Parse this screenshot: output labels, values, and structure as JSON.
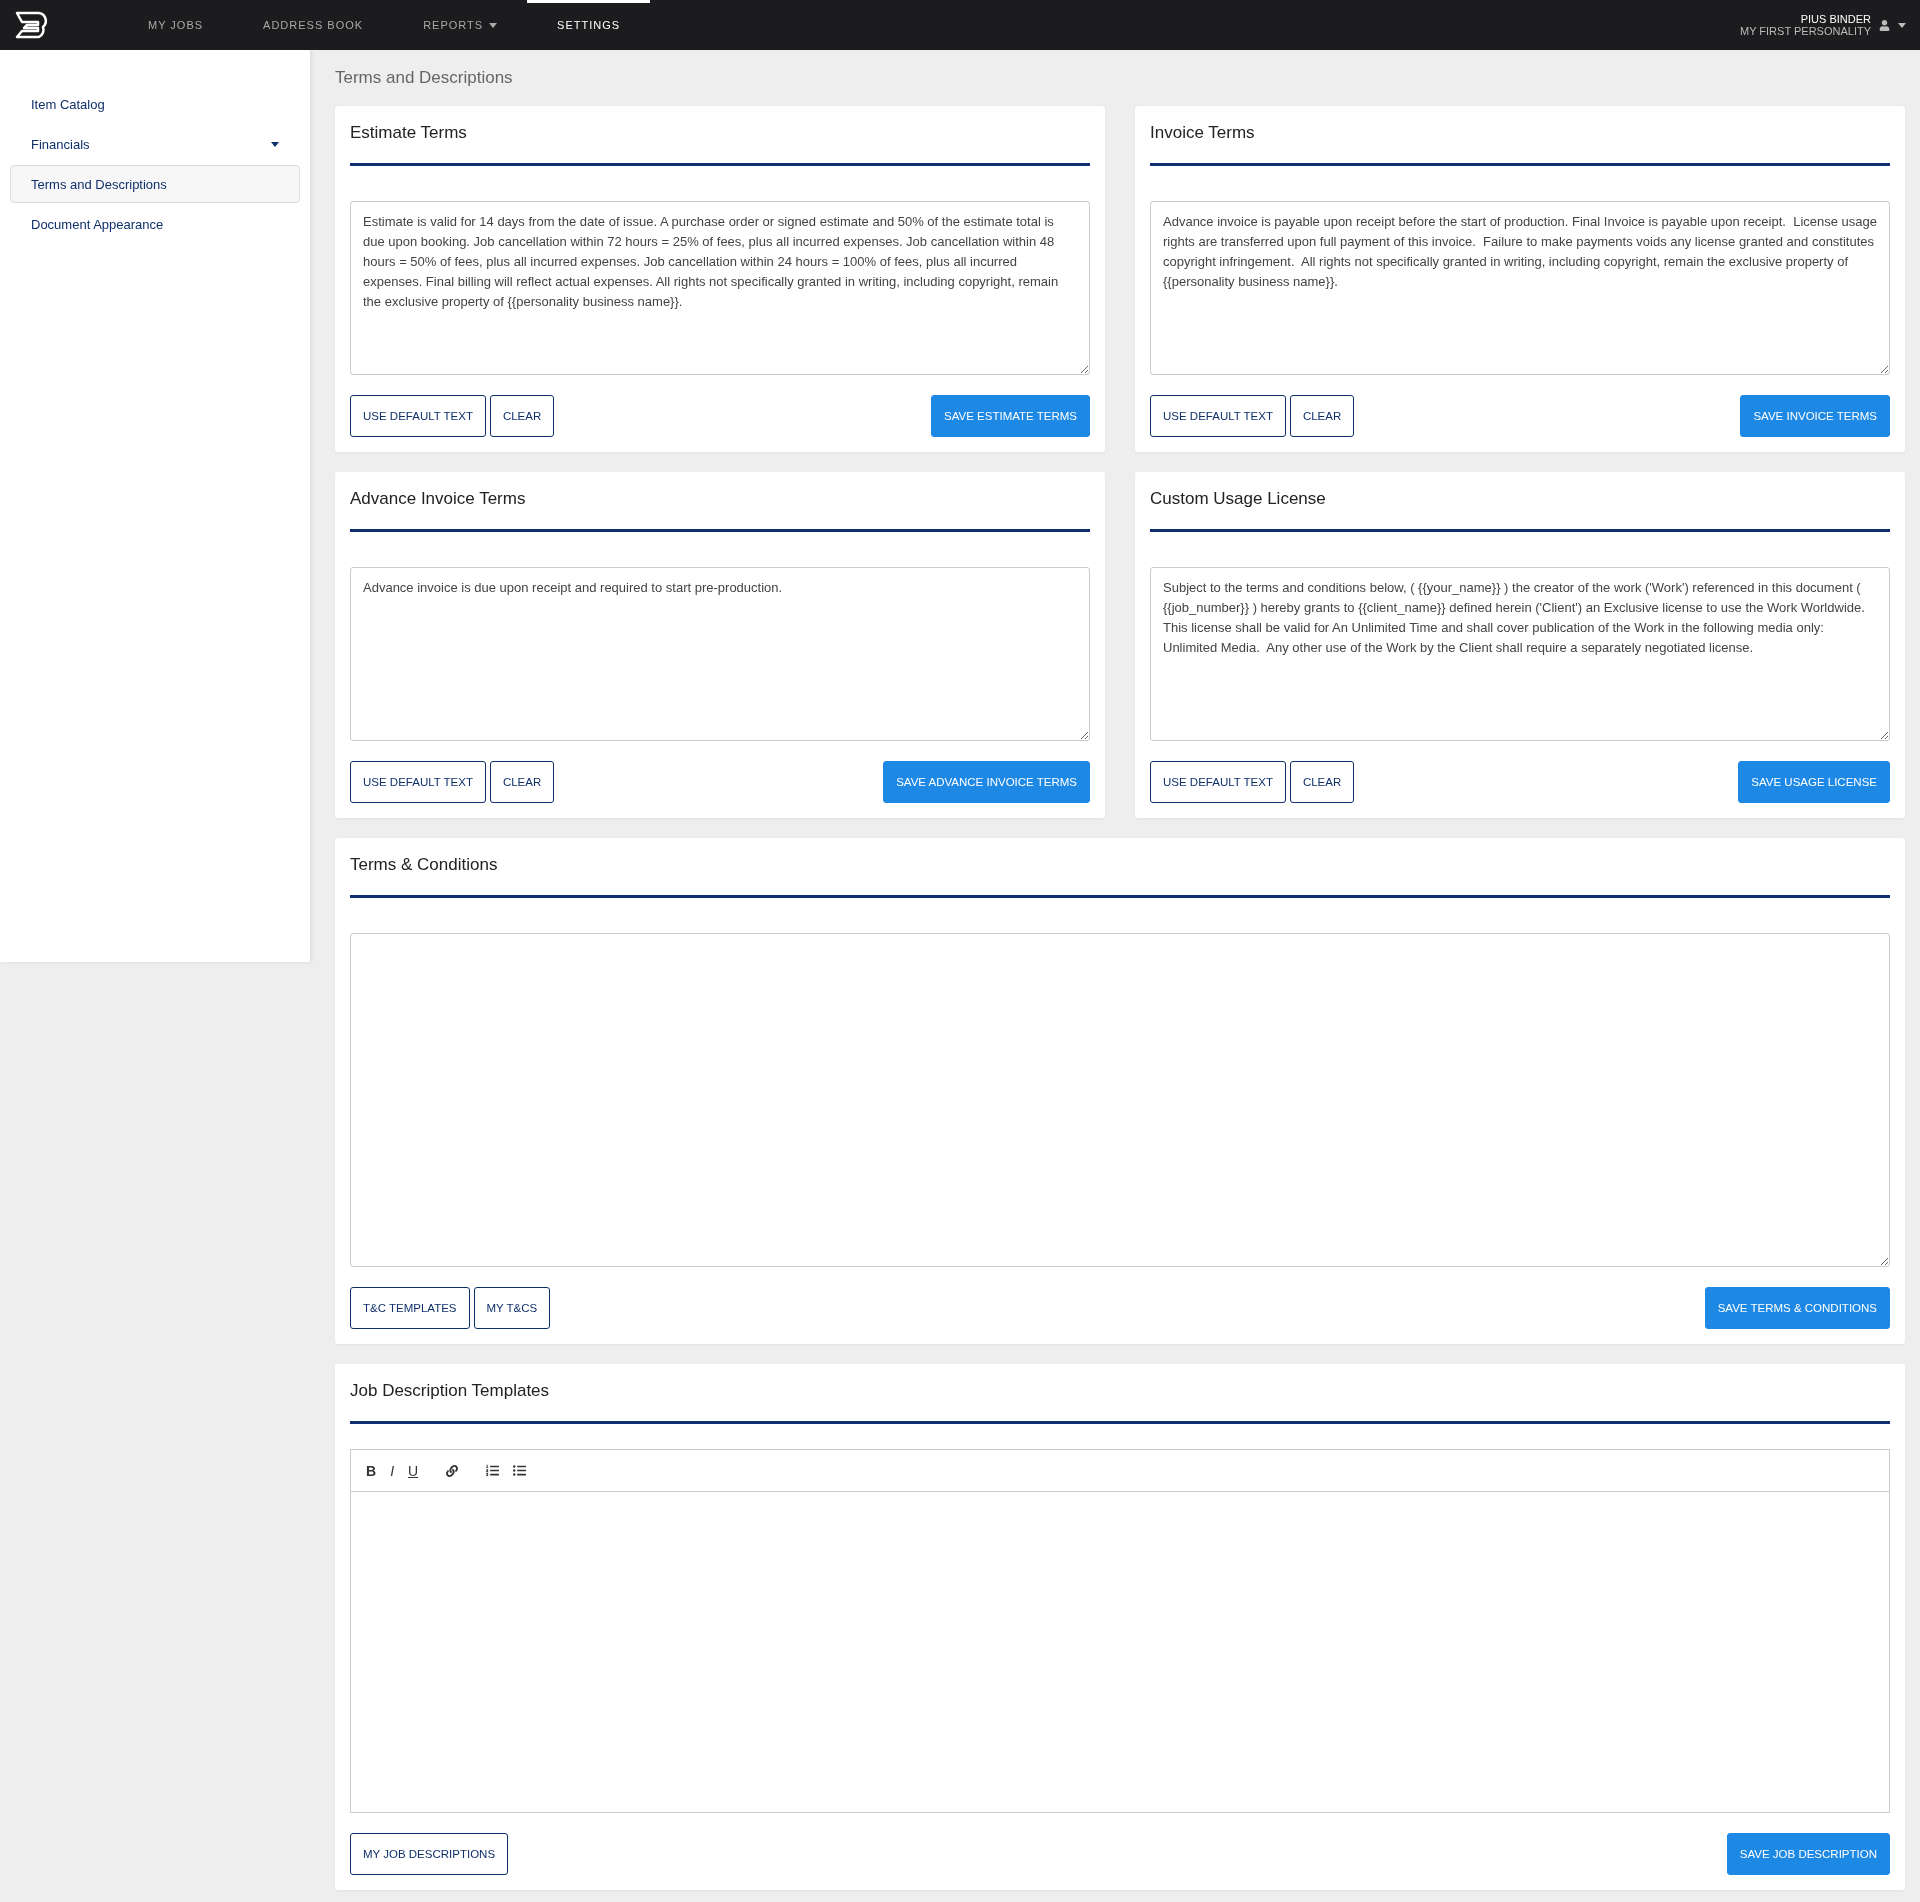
{
  "nav": {
    "items": [
      {
        "label": "MY JOBS",
        "selected": false,
        "dropdown": false
      },
      {
        "label": "ADDRESS BOOK",
        "selected": false,
        "dropdown": false
      },
      {
        "label": "REPORTS",
        "selected": false,
        "dropdown": true
      },
      {
        "label": "SETTINGS",
        "selected": true,
        "dropdown": false
      }
    ],
    "user": {
      "name": "PIUS BINDER",
      "personality": "MY FIRST PERSONALITY"
    }
  },
  "sidebar": {
    "items": [
      {
        "label": "Item Catalog",
        "selected": false,
        "dropdown": false
      },
      {
        "label": "Financials",
        "selected": false,
        "dropdown": true
      },
      {
        "label": "Terms and Descriptions",
        "selected": true,
        "dropdown": false
      },
      {
        "label": "Document Appearance",
        "selected": false,
        "dropdown": false
      }
    ]
  },
  "page_title": "Terms and Descriptions",
  "term_cards": [
    {
      "title": "Estimate Terms",
      "text": "Estimate is valid for 14 days from the date of issue. A purchase order or signed estimate and 50% of the estimate total is due upon booking. Job cancellation within 72 hours = 25% of fees, plus all incurred expenses. Job cancellation within 48 hours = 50% of fees, plus all incurred expenses. Job cancellation within 24 hours = 100% of fees, plus all incurred expenses. Final billing will reflect actual expenses. All rights not specifically granted in writing, including copyright, remain the exclusive property of {{personality business name}}.",
      "buttons": [
        "USE DEFAULT TEXT",
        "CLEAR"
      ],
      "save": "SAVE ESTIMATE TERMS"
    },
    {
      "title": "Invoice Terms",
      "text": "Advance invoice is payable upon receipt before the start of production. Final Invoice is payable upon receipt.  License usage rights are transferred upon full payment of this invoice.  Failure to make payments voids any license granted and constitutes copyright infringement.  All rights not specifically granted in writing, including copyright, remain the exclusive property of {{personality business name}}.",
      "buttons": [
        "USE DEFAULT TEXT",
        "CLEAR"
      ],
      "save": "SAVE INVOICE TERMS"
    },
    {
      "title": "Advance Invoice Terms",
      "text": "Advance invoice is due upon receipt and required to start pre-production.",
      "buttons": [
        "USE DEFAULT TEXT",
        "CLEAR"
      ],
      "save": "SAVE ADVANCE INVOICE TERMS"
    },
    {
      "title": "Custom Usage License",
      "text": "Subject to the terms and conditions below, ( {{your_name}} ) the creator of the work ('Work') referenced in this document ( {{job_number}} ) hereby grants to {{client_name}} defined herein ('Client') an Exclusive license to use the Work Worldwide.  This license shall be valid for An Unlimited Time and shall cover publication of the Work in the following media only: Unlimited Media.  Any other use of the Work by the Client shall require a separately negotiated license.",
      "buttons": [
        "USE DEFAULT TEXT",
        "CLEAR"
      ],
      "save": "SAVE USAGE LICENSE"
    }
  ],
  "terms_conditions": {
    "title": "Terms & Conditions",
    "buttons": [
      "T&C TEMPLATES",
      "MY T&CS"
    ],
    "save": "SAVE TERMS & CONDITIONS"
  },
  "job_descriptions": {
    "title": "Job Description Templates",
    "toolbar": [
      {
        "kind": "bold",
        "label": "B"
      },
      {
        "kind": "italic",
        "label": "I"
      },
      {
        "kind": "underline",
        "label": "U"
      },
      {
        "kind": "link"
      },
      {
        "kind": "ordered"
      },
      {
        "kind": "bullet"
      }
    ],
    "buttons": [
      "MY JOB DESCRIPTIONS"
    ],
    "save": "SAVE JOB DESCRIPTION"
  }
}
